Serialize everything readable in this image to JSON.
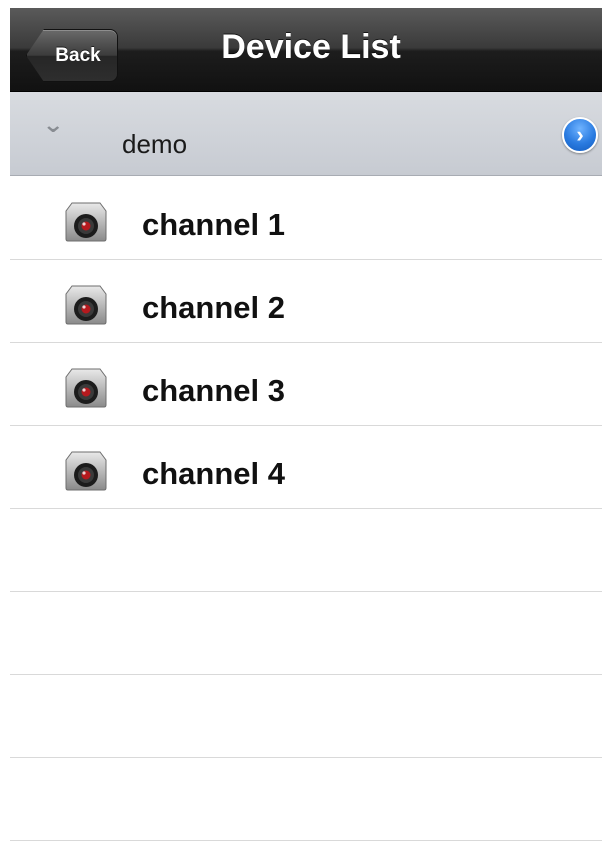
{
  "navbar": {
    "back_label": "Back",
    "title": "Device List"
  },
  "group": {
    "name": "demo",
    "chevron_icon": "chevron-down-icon",
    "disclosure_icon": "disclosure-arrow-icon",
    "accent_color": "#2a7be0"
  },
  "channels": [
    {
      "label": "channel 1",
      "icon": "camera-icon"
    },
    {
      "label": "channel 2",
      "icon": "camera-icon"
    },
    {
      "label": "channel 3",
      "icon": "camera-icon"
    },
    {
      "label": "channel 4",
      "icon": "camera-icon"
    }
  ]
}
